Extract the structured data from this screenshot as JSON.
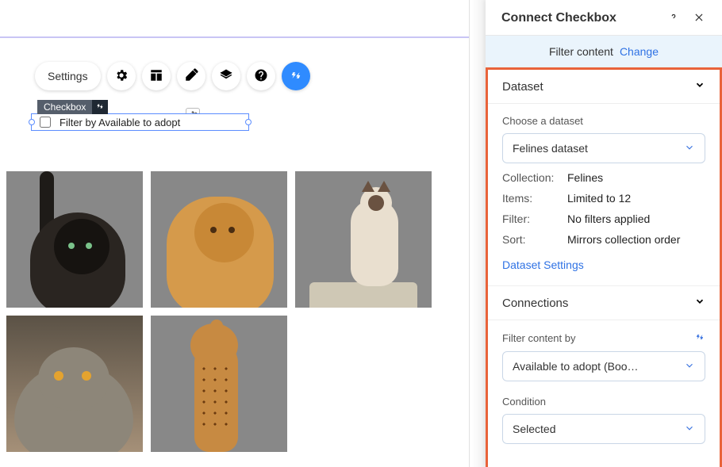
{
  "toolbar": {
    "settings_label": "Settings",
    "icons": {
      "gear": "gear-icon",
      "layout": "layout-icon",
      "brush": "brush-icon",
      "layers": "layers-icon",
      "help": "help-icon",
      "connect": "connect-icon"
    }
  },
  "selected_element": {
    "tag_label": "Checkbox",
    "checkbox_label": "Filter by Available to adopt"
  },
  "gallery": {
    "items": [
      "cat1",
      "cat2",
      "cat3",
      "cat4",
      "cat5"
    ]
  },
  "panel": {
    "title": "Connect Checkbox",
    "banner_text": "Filter content",
    "banner_action": "Change",
    "dataset": {
      "section_title": "Dataset",
      "choose_label": "Choose a dataset",
      "selected_dataset": "Felines dataset",
      "rows": {
        "collection_k": "Collection:",
        "collection_v": "Felines",
        "items_k": "Items:",
        "items_v": "Limited to 12",
        "filter_k": "Filter:",
        "filter_v": "No filters applied",
        "sort_k": "Sort:",
        "sort_v": "Mirrors collection order"
      },
      "settings_link": "Dataset Settings"
    },
    "connections": {
      "section_title": "Connections",
      "filter_by_label": "Filter content by",
      "filter_by_value": "Available to adopt (Boo…",
      "condition_label": "Condition",
      "condition_value": "Selected"
    }
  }
}
